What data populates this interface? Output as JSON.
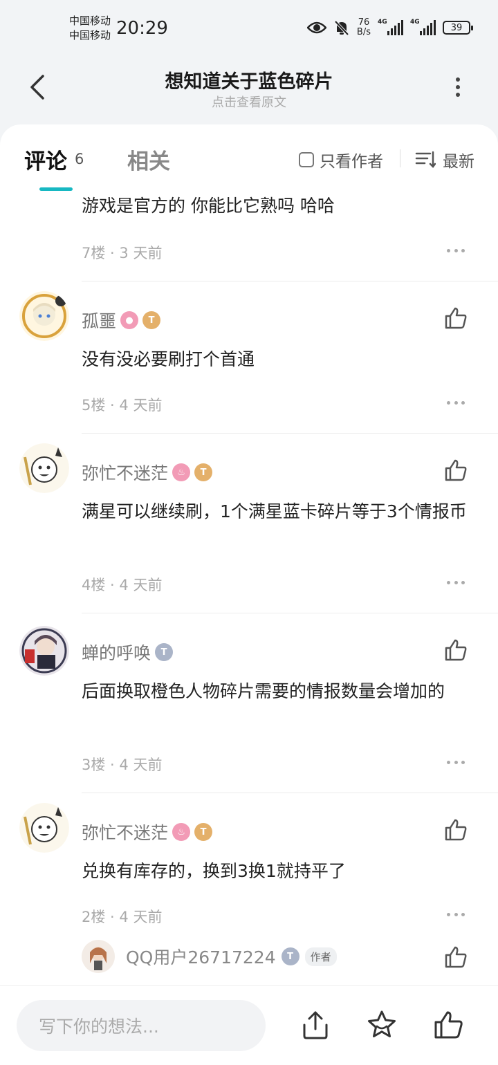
{
  "status_bar": {
    "carrier1": "中国移动",
    "carrier2": "中国移动",
    "time": "20:29",
    "netspeed_value": "76",
    "netspeed_unit": "B/s",
    "signal_label": "4G",
    "battery": "39"
  },
  "header": {
    "title": "想知道关于蓝色碎片",
    "subtitle": "点击查看原文"
  },
  "tabs": {
    "comment_label": "评论",
    "comment_count": "6",
    "related_label": "相关",
    "only_author_label": "只看作者",
    "sort_label": "最新"
  },
  "comments": [
    {
      "text": "游戏是官方的  你能比它熟吗 哈哈",
      "floor": "7楼",
      "time": "3 天前"
    },
    {
      "user": "孤噩",
      "text": "没有没必要刷打个首通",
      "floor": "5楼",
      "time": "4 天前"
    },
    {
      "user": "弥忙不迷茫",
      "text": "满星可以继续刷，1个满星蓝卡碎片等于3个情报币",
      "floor": "4楼",
      "time": "4 天前"
    },
    {
      "user": "蝉的呼唤",
      "text": "后面换取橙色人物碎片需要的情报数量会增加的",
      "floor": "3楼",
      "time": "4 天前"
    },
    {
      "user": "弥忙不迷茫",
      "text": "兑换有库存的，换到3换1就持平了",
      "floor": "2楼",
      "time": "4 天前"
    }
  ],
  "reply": {
    "user": "QQ用户26717224",
    "author_tag": "作者"
  },
  "bottom_bar": {
    "input_placeholder": "写下你的想法..."
  },
  "colors": {
    "accent": "#17b8c2",
    "background": "#f2f4f6",
    "card": "#ffffff"
  }
}
